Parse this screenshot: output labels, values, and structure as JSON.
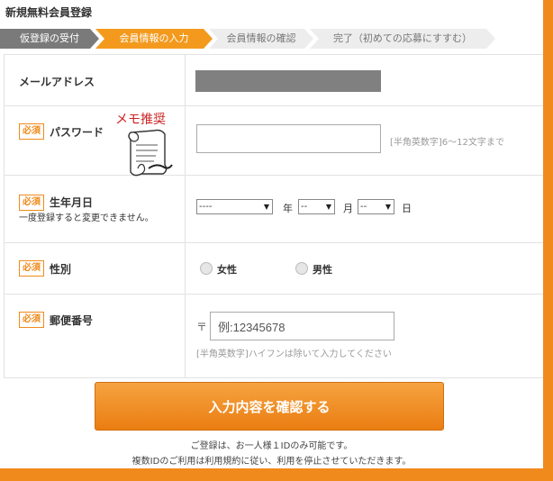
{
  "page": {
    "title": "新規無料会員登録"
  },
  "steps": [
    {
      "label": "仮登録の受付"
    },
    {
      "label": "会員情報の入力"
    },
    {
      "label": "会員情報の確認"
    },
    {
      "label": "完了（初めての応募にすすむ）"
    }
  ],
  "current_step": 2,
  "form": {
    "email": {
      "label": "メールアドレス"
    },
    "password": {
      "required": "必須",
      "label": "パスワード",
      "memo": "メモ推奨",
      "value": "",
      "hint": "[半角英数字]6〜12文字まで"
    },
    "birthdate": {
      "required": "必須",
      "label": "生年月日",
      "note": "一度登録すると変更できません。",
      "year": "----",
      "year_unit": "年",
      "month": "--",
      "month_unit": "月",
      "day": "--",
      "day_unit": "日"
    },
    "gender": {
      "required": "必須",
      "label": "性別",
      "options": [
        "女性",
        "男性"
      ]
    },
    "postal": {
      "required": "必須",
      "label": "郵便番号",
      "prefix": "〒",
      "placeholder": "例:12345678",
      "hint": "[半角英数字]ハイフンは除いて入力してください"
    }
  },
  "submit": {
    "label": "入力内容を確認する"
  },
  "notes": [
    "ご登録は、お一人様１IDのみ可能です。",
    "複数IDのご利用は利用規約に従い、利用を停止させていただきます。"
  ],
  "colors": {
    "accent": "#f08a1c",
    "step_done": "#7a7a7a",
    "step_pending": "#ededed"
  }
}
